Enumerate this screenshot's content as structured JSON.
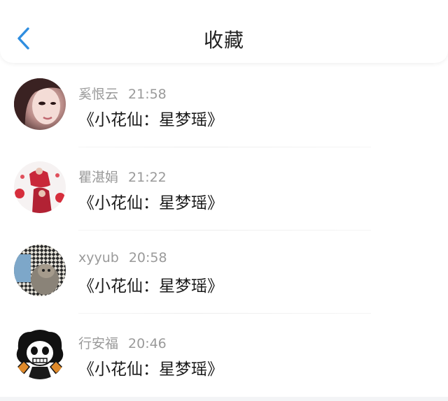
{
  "header": {
    "title": "收藏",
    "back_icon": "chevron-left-icon",
    "accent": "#2f8ee0"
  },
  "items": [
    {
      "name": "奚恨云",
      "time": "21:58",
      "text": "《小花仙：星梦瑶》",
      "avatar_icon": "avatar-girl-photo"
    },
    {
      "name": "瞿湛娟",
      "time": "21:22",
      "text": "《小花仙：星梦瑶》",
      "avatar_icon": "avatar-wedding-photo"
    },
    {
      "name": "xyyub",
      "time": "20:58",
      "text": "《小花仙：星梦瑶》",
      "avatar_icon": "avatar-cat-photo"
    },
    {
      "name": "行安福",
      "time": "20:46",
      "text": "《小花仙：星梦瑶》",
      "avatar_icon": "avatar-skull-cartoon"
    }
  ]
}
